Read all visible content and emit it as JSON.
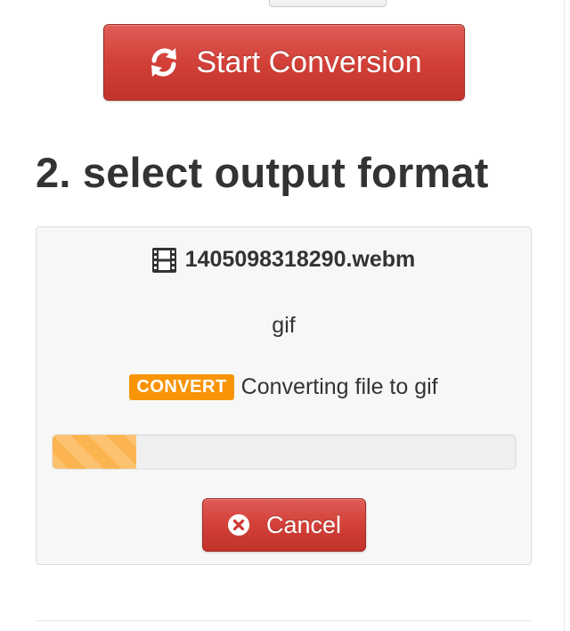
{
  "start_button": {
    "label": "Start Conversion",
    "icon": "refresh-icon"
  },
  "section": {
    "heading": "2. select output format"
  },
  "job": {
    "file_icon": "film-icon",
    "file_name": "1405098318290.webm",
    "output_format": "gif",
    "status_badge": "CONVERT",
    "status_text": "Converting file to gif",
    "progress_fraction": 0.18,
    "cancel_label": "Cancel",
    "cancel_icon": "times-circle-icon"
  },
  "colors": {
    "danger": "#d24038",
    "warning": "#f89406",
    "progress": "#fbb450"
  }
}
